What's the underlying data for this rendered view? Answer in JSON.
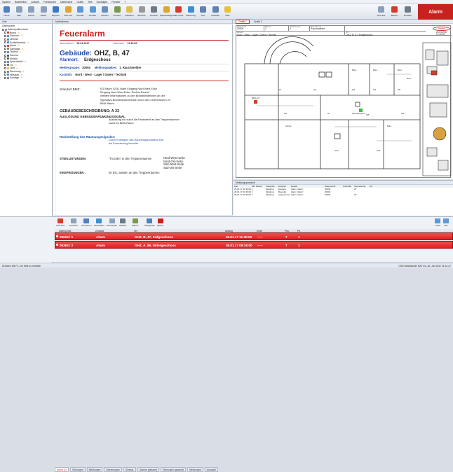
{
  "menu": [
    "System",
    "Bearbeiten",
    "Ansicht",
    "Funktionen",
    "Datenbank",
    "Grafik",
    "Text",
    "Sonstiges",
    "Fenster",
    "?"
  ],
  "toolbar": [
    {
      "label": "Home",
      "color": "#4f7fc4"
    },
    {
      "label": "Start",
      "color": "#8aa0bb"
    },
    {
      "label": "Zurück",
      "color": "#8aa0bb"
    },
    {
      "label": "Weiter",
      "color": "#8aa0bb"
    },
    {
      "label": "Explorer",
      "color": "#3b78c9"
    },
    {
      "label": "Vorh aus",
      "color": "#e0a52b"
    },
    {
      "label": "Simulat.",
      "color": "#5b9bd5"
    },
    {
      "label": "Simulat.",
      "color": "#5b9bd5"
    },
    {
      "label": "Steuern",
      "color": "#6c8ebf"
    },
    {
      "label": "Anmeld.",
      "color": "#7c9a46"
    },
    {
      "label": "Passwort",
      "color": "#e0c04b"
    },
    {
      "label": "Berichte",
      "color": "#999999"
    },
    {
      "label": "Drucken",
      "color": "#6f7a88"
    },
    {
      "label": "Sprachanlage",
      "color": "#e0a52b"
    },
    {
      "label": "Alarm ausl.",
      "color": "#d83a2a"
    },
    {
      "label": "Steuerung",
      "color": "#3a8fd6"
    },
    {
      "label": "Tbxr",
      "color": "#5f82b3"
    },
    {
      "label": "Leitstelle",
      "color": "#5f82b3"
    },
    {
      "label": "Hilfe",
      "color": "#e8c23a"
    }
  ],
  "toolbar_right": [
    {
      "label": "Vorh aus"
    },
    {
      "label": "Bericht"
    },
    {
      "label": "Drucken"
    }
  ],
  "alarm_button": "Alarm",
  "tree": {
    "header": "Orte",
    "sub": "Datenquelle",
    "items": [
      {
        "label": "Datenquellen-Karte",
        "color": "#6a8fc0"
      },
      {
        "label": "Brand",
        "color": "#d83a2a",
        "warn": true
      },
      {
        "label": "Einbruch",
        "color": "#4f7fc4",
        "warn": true
      },
      {
        "label": "Überfall",
        "color": "#4f7fc4"
      },
      {
        "label": "Schließbereich",
        "color": "#4f7fc4",
        "warn": true
      },
      {
        "label": "Notruf",
        "color": "#d83a2a",
        "warn": true
      },
      {
        "label": "Sabotage",
        "color": "#7a7a7a",
        "warn": true
      },
      {
        "label": "Technik",
        "color": "#4f7fc4",
        "warn": true
      },
      {
        "label": "Kamera",
        "color": "#555555"
      },
      {
        "label": "Monitor",
        "color": "#555555"
      },
      {
        "label": "Sprechstelle",
        "color": "#4f7fc4",
        "warn": true
      },
      {
        "label": "Tür",
        "color": "#7b5c3a",
        "warn": true
      },
      {
        "label": "Licht",
        "color": "#e8c23a",
        "warn": true
      },
      {
        "label": "Steuerung",
        "color": "#4f7fc4",
        "warn": true
      },
      {
        "label": "Hilfsstart",
        "color": "#4f7fc4",
        "warn": true
      },
      {
        "label": "Sonstige",
        "color": "#7a7a7a",
        "warn": true
      }
    ]
  },
  "doc": {
    "tab": "Maßnahmen",
    "title": "Feueralarm",
    "date_label": "Alarmdatum:",
    "date": "26.01.2017",
    "time_label": "Alarmzeit:",
    "time": "11:30:00",
    "building_label": "Gebäude:",
    "building": "OHZ, B, 47",
    "alarmort_label": "Alarmort:",
    "alarmort": "Erdgeschoss",
    "melder_label": "Meldergruppe:",
    "melder": "20004",
    "geber_label": "Meldungsgeber:",
    "geber": "1. Rauchmelder",
    "kurz_label": "Kurzinfo:",
    "kurz": "Nord - West - Lager / Daten / Technik",
    "bmz_label": "Standort BMZ:",
    "bmz_lines": [
      "EG,Raum 0218, Nähe Eingang Nord-West Ecke",
      "Eingang Nord West Ecke- Rechts-Rechts",
      "Weitere Informationen zu den Brandmeldelinien an der",
      "Sigmasys-Brandmeldezentrale und in den Linienordnern im",
      "BMA-Raum"
    ],
    "gb_title": "GEBÄUDEBESCHREIBUNG:",
    "gb_value": "A 33",
    "ausl_title": "AUSLÖSUNG GEBÄUDERÄUMUNGSSIGNAL",
    "ausl_lines": [
      "Auslösung nur durch die Feuerwehr an den Treppenräumen",
      "sowie im BMA-Raum."
    ],
    "rueck_title": "Rückstellung des Räumungssignales:",
    "rueck_lines": [
      "Durch Entriegeln des Räumungsschalters wird",
      "die Evakuierung beendet"
    ],
    "steig_label": "STEIGLEITUNGEN:",
    "steig_text": "\"Trocken\" in den Treppenräumen",
    "steig_dirs": [
      "Nord-West-Seite",
      "Nord-Ost-Seite",
      "Süd-West-Seite",
      "Süd-Ost-Seite"
    ],
    "einsp_label": "EINSPEISUNGEN :",
    "einsp_text": "Im EG, aussen an den Treppenräumen"
  },
  "plan": {
    "tabs": [
      "Grafik 1",
      "Grafik 2"
    ],
    "fields": [
      {
        "k": "Datenpunkt",
        "v": "20004"
      },
      {
        "k": "Melder",
        "v": "1"
      },
      {
        "k": "Meldebereich",
        "v": "4"
      },
      {
        "k": "Bezeichnung",
        "v": "Rauchmelder"
      }
    ],
    "area_label": "Bereich",
    "area": "Nord - West - Lager / Daten / Technik",
    "ort_label": "Ort",
    "ort": "OHZ, B, 47, Erdgeschoss",
    "date": "26.01.2017",
    "time": "11:30:00",
    "logo": "Henkel",
    "rooms": [
      "Büro",
      "Büro",
      "Büro",
      "Büro",
      "Küche",
      "Wendeltreppe",
      "Büro"
    ],
    "codes": [
      "0/1",
      "0/2",
      "0/3",
      "0/4",
      "0/5",
      "0/6",
      "0/7",
      "0/8",
      "0/9",
      "0/10",
      "0/11",
      "BMA 0/1"
    ]
  },
  "messages": {
    "title": "Meldungsprotokoll",
    "headers": [
      "Zeit",
      "MN",
      "Modul",
      "Kategorie",
      "Ereignis",
      "Details",
      "Datenpunkt",
      "Kontrolle",
      "Vermerkung",
      "Ort"
    ],
    "rows": [
      [
        "26.01.17 11:30:00",
        "1",
        "",
        "Meldung",
        "Eingang",
        "Alarm 'Alarm'",
        "20004",
        "",
        "AT"
      ],
      [
        "26.01.17 11:30:00",
        "1",
        "",
        "Meldung",
        "Beendet",
        "Alarm 'Alarm'",
        "20004",
        "",
        ""
      ],
      [
        "26.01.17 11:30:00",
        "1",
        "",
        "Meldung",
        "Angenommen",
        "Alarm 'Alarm'",
        "20004",
        "",
        "AT"
      ]
    ]
  },
  "bottom_tools": [
    "Vorh aus",
    "Loeschen",
    "Annehmen",
    "Abschalten",
    "Erschöpfen",
    "Schließ.",
    "Fahren",
    "Übergeben",
    "Sperre"
  ],
  "bottom_right": [
    "Lokal",
    "Alle"
  ],
  "alarms": {
    "headers": [
      "Datenpunkt",
      "Zustand",
      "Ort",
      "Anfang",
      "Ende",
      "Pos.",
      "Pri."
    ],
    "rows": [
      {
        "dp": "20004 / 1",
        "state": "Alarm",
        "ort": "OHZ, B, 47, Erdgeschoss",
        "start": "26.01.17 11:30:00",
        "end": "-----",
        "pos": "7",
        "pri": "1"
      },
      {
        "dp": "05363 / 2",
        "state": "Alarm",
        "ort": "OHZ, A, 86, Untergeschoss",
        "start": "26.01.17 09:16:00",
        "end": "-----",
        "pos": "7",
        "pri": "1"
      }
    ]
  },
  "bottom_tabs": [
    "Alarm (2)",
    "Störungen",
    "Meldungen",
    "Steuerungen",
    "Simulat.",
    "Alarme (gesamt)",
    "Störungen (gesamt)",
    "Meldungen",
    "Auswahl"
  ],
  "status_left": "Drücken Sie F1, um Hilfe zu erhalten",
  "status_right": "CSD Handbücher  NAT  Do, 26. Jan 2017  11:31:27"
}
